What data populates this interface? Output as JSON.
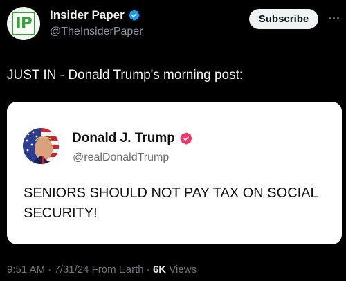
{
  "account": {
    "logo_text": "IP",
    "display_name": "Insider Paper",
    "handle": "@TheInsiderPaper",
    "subscribe_label": "Subscribe"
  },
  "post": {
    "text": "JUST IN - Donald Trump's morning post:"
  },
  "quoted": {
    "display_name": "Donald J. Trump",
    "handle": "@realDonaldTrump",
    "body": "SENIORS SHOULD NOT PAY TAX ON SOCIAL SECURITY!"
  },
  "meta": {
    "time": "9:51 AM",
    "sep1": " · ",
    "date": "7/31/24",
    "source": " From Earth",
    "sep2": " · ",
    "views_count": "6K",
    "views_label": " Views"
  },
  "colors": {
    "background": "#000000",
    "verified_blue": "#1d9bf0",
    "verified_pink": "#f0386b",
    "logo_green": "#39a33b"
  },
  "icons": {
    "verified": "verified-badge-icon",
    "more": "more-horizontal-icon"
  }
}
